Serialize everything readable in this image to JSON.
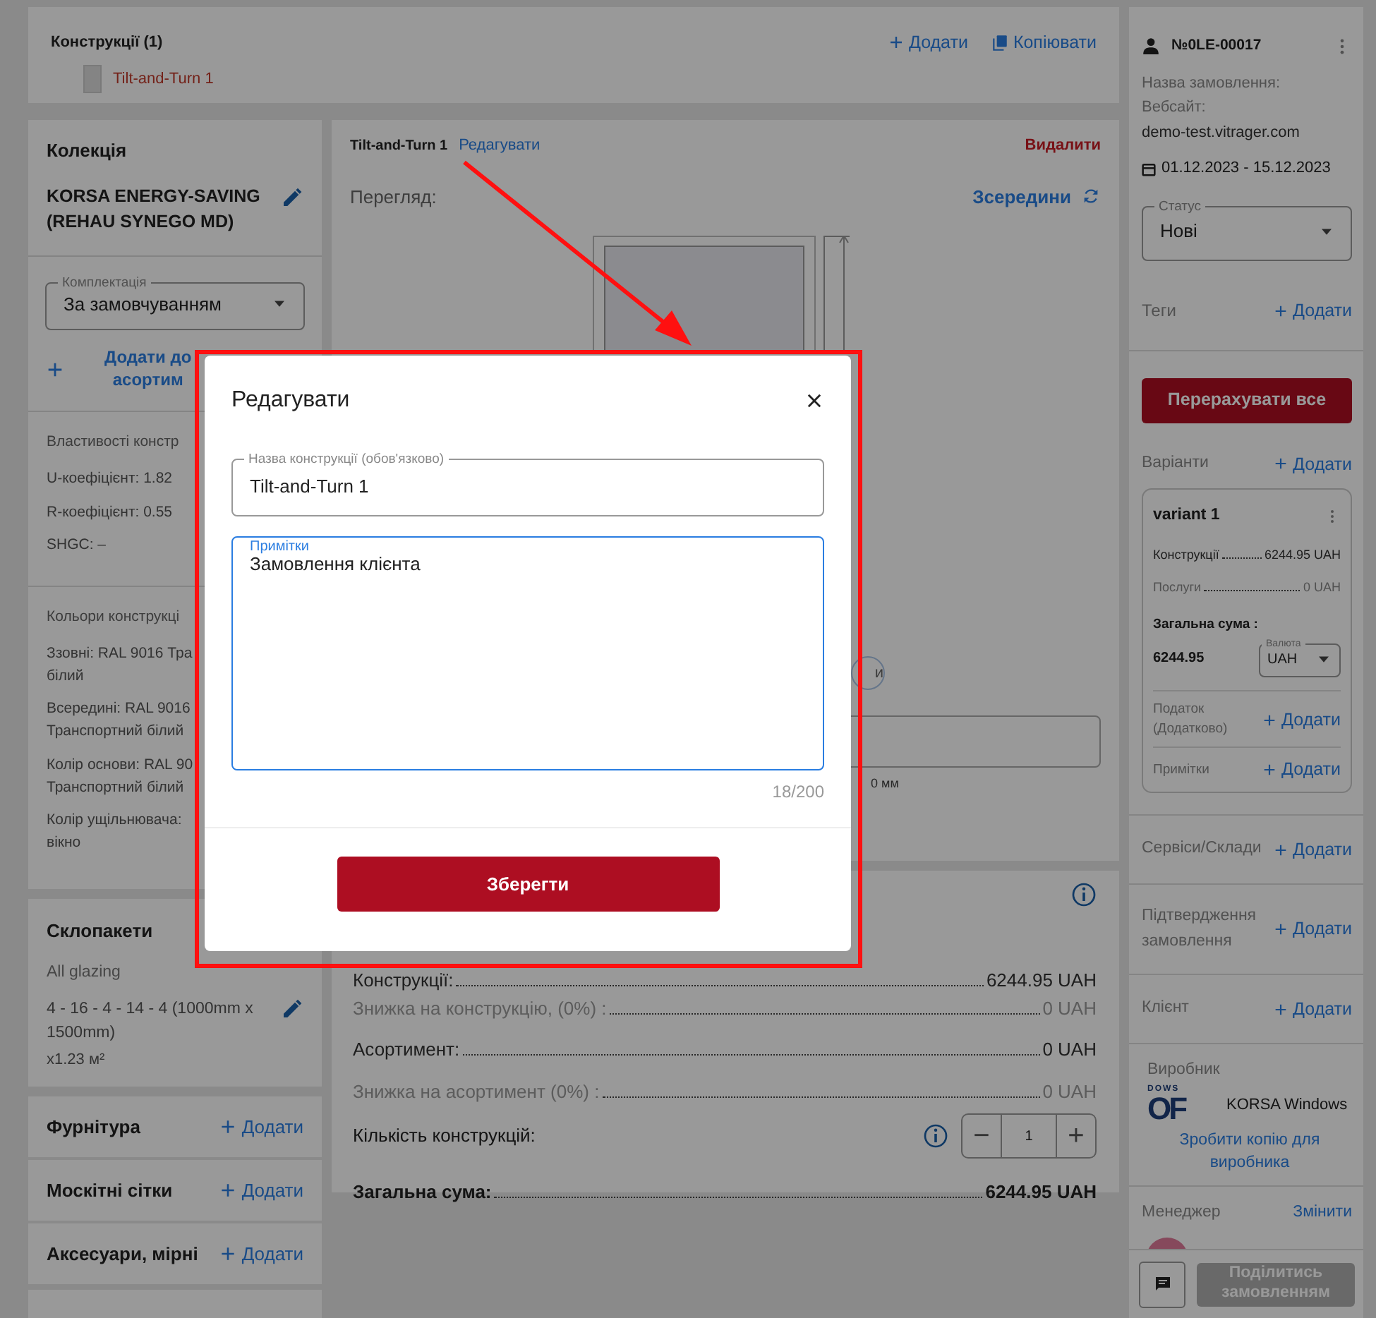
{
  "constructions_bar": {
    "title": "Конструкції (1)",
    "add": "Додати",
    "copy": "Копіювати",
    "items": [
      {
        "label": "Tilt-and-Turn 1",
        "selected": true
      }
    ]
  },
  "collection": {
    "title": "Колекція",
    "name": "KORSA ENERGY-SAVING (REHAU SYNEGO MD)",
    "set_select": {
      "label": "Комплектація",
      "value": "За замовчуванням"
    },
    "add_assortment": "Додати до\nасортим"
  },
  "properties": {
    "title": "Властивості констр",
    "items": [
      "U-коефіцієнт: 1.82",
      "R-коефіцієнт: 0.55",
      "SHGC: –"
    ]
  },
  "colors": {
    "title": "Кольори конструкці",
    "items": [
      "Ззовні: RAL 9016 Тра\nбілий",
      "Всередині: RAL 9016\nТранспортний білий",
      "Колір основи: RAL 90\nТранспортний білий",
      "Колір ущільнювача:\nвікно"
    ]
  },
  "glazing": {
    "title": "Склопакети",
    "subtitle": "All glazing",
    "spec": "4 - 16 - 4 - 14 - 4 (1000mm x 1500mm)",
    "area": "x1.23 м²"
  },
  "addon_sections": [
    {
      "title": "Фурнітура",
      "action": "Додати"
    },
    {
      "title": "Москітні сітки",
      "action": "Додати"
    },
    {
      "title": "Аксесуари, мірні",
      "action": "Додати"
    }
  ],
  "construction": {
    "name": "Tilt-and-Turn 1",
    "edit": "Редагувати",
    "delete": "Видалити",
    "view_label": "Перегляд:",
    "view_value": "Зсередини",
    "fragment_button": "и",
    "fragment_size": "0 мм"
  },
  "summary": {
    "rows": [
      {
        "label": "Конструкції:",
        "value": "6244.95 UAH",
        "muted": false
      },
      {
        "label": "Знижка на конструкцію, (0%) :",
        "value": "0 UAH",
        "muted": true
      },
      {
        "label": "Асортимент:",
        "value": "0 UAH",
        "muted": false
      },
      {
        "label": "Знижка на асортимент (0%) :",
        "value": "0 UAH",
        "muted": true
      }
    ],
    "quantity": {
      "label": "Кількість конструкцій:",
      "value": "1",
      "minus": "−",
      "plus": "+"
    },
    "total": {
      "label": "Загальна сума:",
      "value": "6244.95 UAH"
    }
  },
  "order": {
    "number": "№0LE-00017",
    "name_label": "Назва замовлення:",
    "website_label": "Вебсайт:",
    "website": "demo-test.vitrager.com",
    "dates": "01.12.2023 - 15.12.2023",
    "status_select": {
      "label": "Статус",
      "value": "Нові"
    },
    "tags": {
      "title": "Теги",
      "action": "Додати"
    },
    "recalc": "Перерахувати все",
    "variants": {
      "title": "Варіанти",
      "action": "Додати"
    },
    "variant": {
      "name": "variant 1",
      "rows": [
        {
          "label": "Конструкції",
          "value": "6244.95 UAH"
        },
        {
          "label": "Послуги",
          "value": "0 UAH"
        }
      ],
      "total_label": "Загальна сума :",
      "total": "6244.95",
      "currency_select": {
        "label": "Валюта",
        "value": "UAH"
      },
      "extras": [
        {
          "title": "Податок (Додатково)",
          "action": "Додати"
        },
        {
          "title": "Примітки",
          "action": "Додати"
        }
      ]
    },
    "sections": [
      {
        "title": "Сервіси/Склади",
        "action": "Додати"
      },
      {
        "title": "Підтвердження замовлення",
        "action": "Додати"
      },
      {
        "title": "Клієнт",
        "action": "Додати"
      }
    ],
    "manufacturer": {
      "title": "Виробник",
      "logo_top": "DOWS",
      "logo_main": "OF",
      "name": "KORSA Windows",
      "copy_link": "Зробити копію для виробника"
    },
    "manager": {
      "title": "Менеджер",
      "action": "Змінити"
    },
    "share": {
      "label": "Поділитись замовленням",
      "disabled": true
    }
  },
  "modal": {
    "title": "Редагувати",
    "name_field": {
      "label": "Назва конструкції (обов'язково)",
      "value": "Tilt-and-Turn 1"
    },
    "notes_field": {
      "label": "Примітки",
      "value": "Замовлення клієнта",
      "focused": true
    },
    "counter": "18/200",
    "save": "Зберегти"
  }
}
